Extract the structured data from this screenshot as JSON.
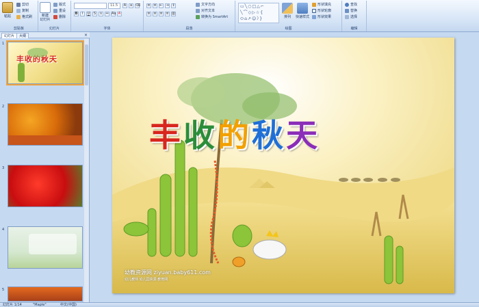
{
  "ribbon": {
    "groups": [
      "剪贴板",
      "幻灯片",
      "字体",
      "段落",
      "绘图",
      "编辑"
    ],
    "paste": "粘贴",
    "cut": "剪切",
    "copy": "复制",
    "format_painter": "格式刷",
    "new_slide": "新建\n幻灯片",
    "layout": "版式",
    "reset": "重设",
    "delete": "删除",
    "font_name": "",
    "font_size": "11.5",
    "text_direction": "文字方向",
    "align_text": "对齐文本",
    "convert_smartart": "转换为 SmartArt",
    "arrange": "排列",
    "quick_styles": "快速样式",
    "shape_fill": "形状填充",
    "shape_outline": "形状轮廓",
    "shape_effects": "形状效果",
    "find": "查找",
    "replace": "替换",
    "select": "选择"
  },
  "sidebar": {
    "tabs": [
      "幻灯片",
      "大纲"
    ],
    "close": "×",
    "slides": [
      {
        "num": "1",
        "title": "丰收的秋天"
      },
      {
        "num": "2"
      },
      {
        "num": "3"
      },
      {
        "num": "4"
      },
      {
        "num": "5"
      }
    ]
  },
  "slide": {
    "title_chars": [
      "丰",
      "收",
      "的",
      "秋",
      "天"
    ],
    "title_colors": [
      "#d7261e",
      "#2b8d3a",
      "#f2a000",
      "#1f6fd6",
      "#8a2db8"
    ],
    "watermark": "幼教资源网 ziyuan.baby611.com",
    "watermark_sub": "幼儿教师 幼儿园资源 教育网"
  },
  "status": {
    "slide_pos": "幻灯片 1/14",
    "theme": "\"Maple\"",
    "language": "中文(中国)"
  },
  "colors": {
    "ribbon_bg": "#dbe7f6",
    "workspace_bg": "#c5d9f1",
    "selection": "#f2a33a"
  }
}
